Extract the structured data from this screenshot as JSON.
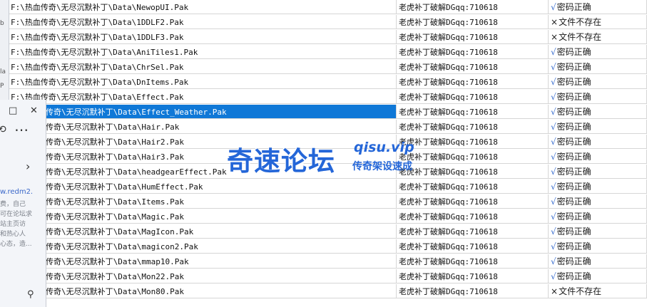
{
  "rows": [
    {
      "path": "F:\\热血传奇\\无尽沉默补丁\\Data\\NewopUI.Pak",
      "password": "老虎补丁破解DGqq:710618",
      "status": "密码正确",
      "ok": true
    },
    {
      "path": "F:\\热血传奇\\无尽沉默补丁\\Data\\1DDLF2.Pak",
      "password": "老虎补丁破解DGqq:710618",
      "status": "文件不存在",
      "ok": false
    },
    {
      "path": "F:\\热血传奇\\无尽沉默补丁\\Data\\1DDLF3.Pak",
      "password": "老虎补丁破解DGqq:710618",
      "status": "文件不存在",
      "ok": false
    },
    {
      "path": "F:\\热血传奇\\无尽沉默补丁\\Data\\AniTiles1.Pak",
      "password": "老虎补丁破解DGqq:710618",
      "status": "密码正确",
      "ok": true
    },
    {
      "path": "F:\\热血传奇\\无尽沉默补丁\\Data\\ChrSel.Pak",
      "password": "老虎补丁破解DGqq:710618",
      "status": "密码正确",
      "ok": true
    },
    {
      "path": "F:\\热血传奇\\无尽沉默补丁\\Data\\DnItems.Pak",
      "password": "老虎补丁破解DGqq:710618",
      "status": "密码正确",
      "ok": true
    },
    {
      "path": "F:\\热血传奇\\无尽沉默补丁\\Data\\Effect.Pak",
      "password": "老虎补丁破解DGqq:710618",
      "status": "密码正确",
      "ok": true
    },
    {
      "path": "传奇\\无尽沉默补丁\\Data\\Effect_Weather.Pak",
      "password": "老虎补丁破解DGqq:710618",
      "status": "密码正确",
      "ok": true,
      "selected": true
    },
    {
      "path": "传奇\\无尽沉默补丁\\Data\\Hair.Pak",
      "password": "老虎补丁破解DGqq:710618",
      "status": "密码正确",
      "ok": true
    },
    {
      "path": "传奇\\无尽沉默补丁\\Data\\Hair2.Pak",
      "password": "老虎补丁破解DGqq:710618",
      "status": "密码正确",
      "ok": true
    },
    {
      "path": "传奇\\无尽沉默补丁\\Data\\Hair3.Pak",
      "password": "老虎补丁破解DGqq:710618",
      "status": "密码正确",
      "ok": true
    },
    {
      "path": "传奇\\无尽沉默补丁\\Data\\headgearEffect.Pak",
      "password": "老虎补丁破解DGqq:710618",
      "status": "密码正确",
      "ok": true
    },
    {
      "path": "传奇\\无尽沉默补丁\\Data\\HumEffect.Pak",
      "password": "老虎补丁破解DGqq:710618",
      "status": "密码正确",
      "ok": true
    },
    {
      "path": "传奇\\无尽沉默补丁\\Data\\Items.Pak",
      "password": "老虎补丁破解DGqq:710618",
      "status": "密码正确",
      "ok": true
    },
    {
      "path": "传奇\\无尽沉默补丁\\Data\\Magic.Pak",
      "password": "老虎补丁破解DGqq:710618",
      "status": "密码正确",
      "ok": true
    },
    {
      "path": "传奇\\无尽沉默补丁\\Data\\MagIcon.Pak",
      "password": "老虎补丁破解DGqq:710618",
      "status": "密码正确",
      "ok": true
    },
    {
      "path": "传奇\\无尽沉默补丁\\Data\\magicon2.Pak",
      "password": "老虎补丁破解DGqq:710618",
      "status": "密码正确",
      "ok": true
    },
    {
      "path": "传奇\\无尽沉默补丁\\Data\\mmap10.Pak",
      "password": "老虎补丁破解DGqq:710618",
      "status": "密码正确",
      "ok": true
    },
    {
      "path": "传奇\\无尽沉默补丁\\Data\\Mon22.Pak",
      "password": "老虎补丁破解DGqq:710618",
      "status": "密码正确",
      "ok": true
    },
    {
      "path": "传奇\\无尽沉默补丁\\Data\\Mon80.Pak",
      "password": "老虎补丁破解DGqq:710618",
      "status": "文件不存在",
      "ok": false
    }
  ],
  "side_panel": {
    "url_text": "w.redm2.",
    "blurb_lines": [
      "费，自己",
      "可在论坛求",
      "站主页访",
      "和热心人",
      "心态，造..."
    ],
    "icons": {
      "restore": "restore-icon",
      "close": "close-icon",
      "more": "more-icon",
      "refresh": "refresh-icon",
      "chevron": "chevron-right-icon",
      "search": "search-icon"
    }
  },
  "watermark": {
    "title": "奇速论坛",
    "site": "qisu.vip",
    "subtitle": "传奇架设速成"
  },
  "colors": {
    "selected_bg": "#0f78d7",
    "check": "#3b6fd0",
    "watermark": "#2466d8"
  }
}
